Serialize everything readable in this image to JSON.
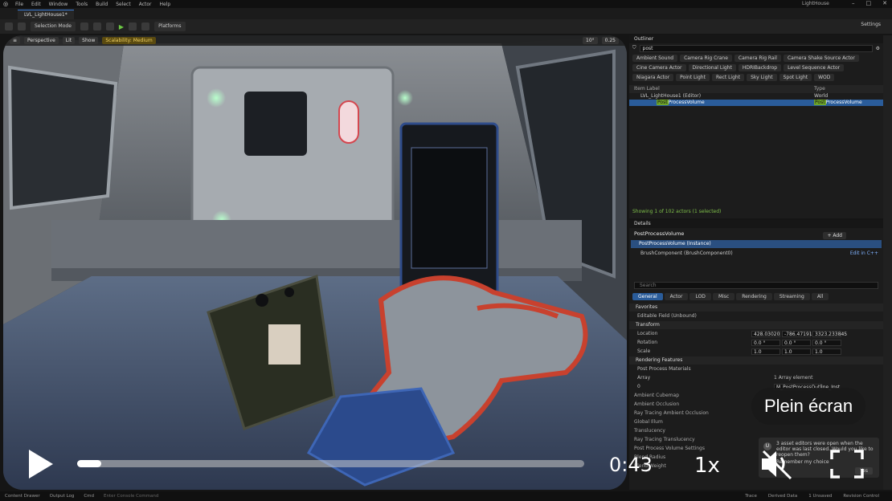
{
  "window": {
    "title": "LightHouse",
    "menu": [
      "File",
      "Edit",
      "Window",
      "Tools",
      "Build",
      "Select",
      "Actor",
      "Help"
    ],
    "level_tab": "LVL_LightHouse1*"
  },
  "toolbar": {
    "selection_mode": "Selection Mode",
    "platforms": "Platforms",
    "settings": "Settings"
  },
  "viewport": {
    "perspective": "Perspective",
    "lit": "Lit",
    "show": "Show",
    "scalability": "Scalability: Medium",
    "fov_value": "10°",
    "snap_value": "0.25"
  },
  "outliner": {
    "tab": "Outliner",
    "search_value": "post",
    "filter_chips": [
      "Ambient Sound",
      "Camera Rig Crane",
      "Camera Rig Rail",
      "Camera Shake Source Actor",
      "Cine Camera Actor",
      "Directional Light",
      "HDRIBackdrop",
      "Level Sequence Actor",
      "Niagara Actor",
      "Point Light",
      "Rect Light",
      "Sky Light",
      "Spot Light",
      "WOD"
    ],
    "columns": [
      "Item Label",
      "Type"
    ],
    "rows": [
      {
        "label": "LVL_LightHouse1 (Editor)",
        "type": "World"
      },
      {
        "label_hl": "Post",
        "label_rest": "ProcessVolume",
        "type_hl": "Post",
        "type_rest": "ProcessVolume"
      }
    ],
    "status": "Showing 1 of 102 actors (1 selected)"
  },
  "details": {
    "tab": "Details",
    "object_name": "PostProcessVolume",
    "add_label": "+ Add",
    "component": "PostProcessVolume (Instance)",
    "subcomponent": "BrushComponent (BrushComponent0)",
    "edit_link": "Edit in C++",
    "search_placeholder": "Search",
    "tabs": [
      "General",
      "Actor",
      "LOD",
      "Misc",
      "Rendering",
      "Streaming",
      "All"
    ],
    "sections": {
      "favorites": "Favorites",
      "editable_field": "Editable Field (Unbound)",
      "transform": "Transform",
      "location": "Location",
      "rotation": "Rotation",
      "scale": "Scale",
      "location_vals": [
        "428.03020",
        "-786.47191",
        "3323.233845"
      ],
      "rotation_vals": [
        "0.0 °",
        "0.0 °",
        "0.0 °"
      ],
      "scale_vals": [
        "1.0",
        "1.0",
        "1.0"
      ],
      "rendering_features": "Rendering Features",
      "ppm": "Post Process Materials",
      "array": "Array",
      "array_count": "1 Array element",
      "array_index": "0",
      "array_value": "M_PostProcessOutline_Inst",
      "collapsed": [
        "Ambient Cubemap",
        "Ambient Occlusion",
        "Ray Tracing Ambient Occlusion",
        "Global Illum",
        "Translucency",
        "Ray Tracing Translucency",
        "Post Process Volume Settings",
        "Blend Radius",
        "Blend Weight"
      ]
    }
  },
  "toast": {
    "text": "3 asset editors were open when the editor was last closed. Would you like to reopen them?",
    "remember": "Remember my choice",
    "button": "Yes"
  },
  "statusbar": {
    "items": [
      "Content Drawer",
      "Output Log",
      "Cmd"
    ],
    "cmd_placeholder": "Enter Console Command",
    "right": [
      "Trace",
      "Derived Data",
      "1 Unsaved",
      "Revision Control"
    ]
  },
  "video": {
    "time": "0:43",
    "speed": "1x",
    "tooltip": "Plein écran",
    "progress": 0.047
  },
  "colors": {
    "accent": "#2a5c9a",
    "highlight": "#6ea52a"
  }
}
